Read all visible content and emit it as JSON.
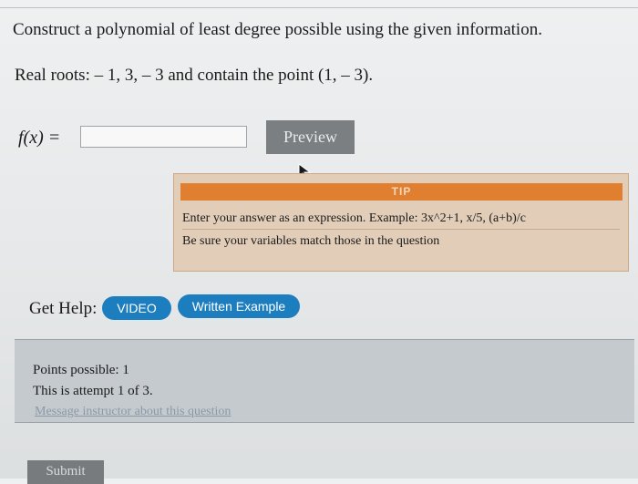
{
  "question": {
    "prompt": "Construct a polynomial of least degree possible using the given information.",
    "given": "Real roots: – 1, 3, – 3 and contain the point (1, – 3)."
  },
  "answer": {
    "label": "f(x) =",
    "value": ""
  },
  "preview_button": "Preview",
  "tip": {
    "header": "TIP",
    "line1": "Enter your answer as an expression. Example: 3x^2+1, x/5, (a+b)/c",
    "line2": "Be sure your variables match those in the question"
  },
  "help": {
    "label": "Get Help:",
    "video": "VIDEO",
    "example": "Written Example"
  },
  "points": {
    "possible": "Points possible: 1",
    "attempt": "This is attempt 1 of 3.",
    "message_link": "Message instructor about this question"
  },
  "submit_button": "Submit",
  "colors": {
    "tip_header": "#e07f2f",
    "tip_bg": "#e2cdb8",
    "pill_blue": "#1c7ebf",
    "preview_gray": "#7b7f82",
    "points_bg": "#c4cace"
  }
}
